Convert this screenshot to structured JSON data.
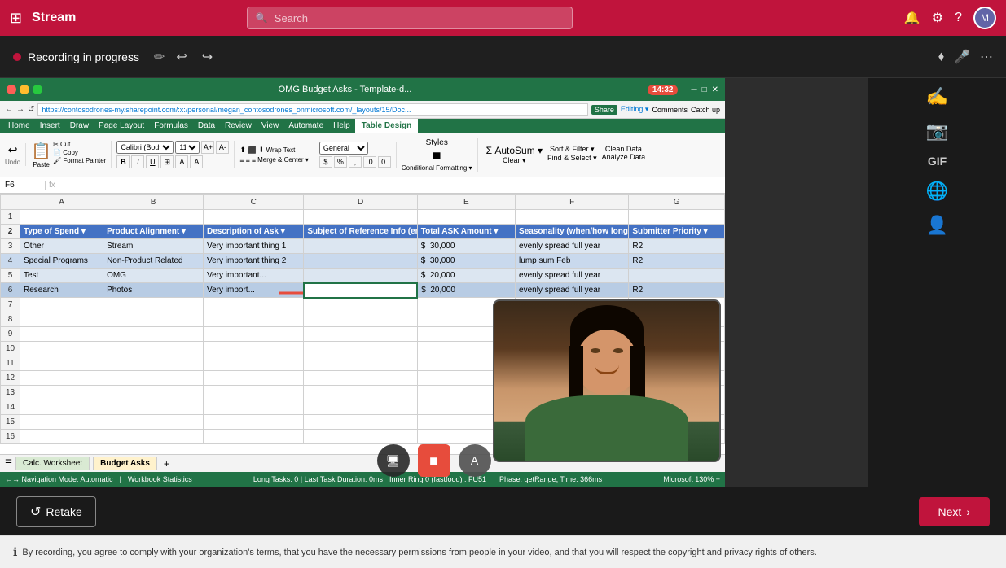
{
  "app": {
    "name": "Stream",
    "search_placeholder": "Search"
  },
  "topnav": {
    "grid_icon": "⊞",
    "notification_icon": "🔔",
    "settings_icon": "⚙",
    "help_icon": "?",
    "avatar_text": "M"
  },
  "recording_bar": {
    "status": "Recording in progress",
    "undo_icon": "↩",
    "redo_icon": "↪",
    "pen_icon": "✏",
    "wand_icon": "⬦",
    "more_icon": "⋯"
  },
  "excel": {
    "title": "OMG Budget Asks - Template-d...",
    "url": "https://contosodrones-my.sharepoint.com/:x:/personal/megan_contosodrones_onmicrosoft.com/_layouts/15/Doc...",
    "timer": "14:32",
    "tabs": [
      "Home",
      "Insert",
      "Draw",
      "Page Layout",
      "Formulas",
      "Data",
      "Review",
      "View",
      "Automate",
      "Help",
      "Table Design"
    ],
    "active_tab": "Table Design",
    "formula_bar_ref": "F6",
    "formula_bar_value": "",
    "sheet_tabs": [
      "Calc. Worksheet",
      "Budget Asks"
    ],
    "columns": [
      "Type of Spend",
      "Product Alignment",
      "Description of Ask",
      "Subject of Reference Info (email or other...)",
      "Total ASK Amount",
      "Seasonality (when/how long)",
      "Submitter Priority"
    ],
    "rows": [
      {
        "num": "3",
        "type": "Other",
        "product": "Stream",
        "desc": "Very important thing 1",
        "subject": "",
        "amount": "$ 30,000",
        "season": "evenly spread full year",
        "priority": "R2"
      },
      {
        "num": "4",
        "type": "Special Programs",
        "product": "Non-Product Related",
        "desc": "Very important thing 2",
        "subject": "",
        "amount": "$ 30,000",
        "season": "lump sum Feb",
        "priority": "R2"
      },
      {
        "num": "5",
        "type": "Test",
        "product": "OMG",
        "desc": "Very important...",
        "subject": "",
        "amount": "$ 20,000",
        "season": "evenly spread full year",
        "priority": ""
      },
      {
        "num": "6",
        "type": "Research",
        "product": "Photos",
        "desc": "Very import...",
        "subject": "",
        "amount": "$ 20,000",
        "season": "evenly spread full year",
        "priority": "R2"
      }
    ]
  },
  "bottom": {
    "retake_label": "Retake",
    "next_label": "Next",
    "disclaimer": "By recording, you agree to comply with your organization's terms, that you have the necessary permissions from people in your video, and that you will respect the copyright and privacy rights of others."
  },
  "sidebar_tools": [
    {
      "name": "pen-tool",
      "icon": "✍"
    },
    {
      "name": "camera-tool",
      "icon": "📷"
    },
    {
      "name": "gif-tool",
      "icon": "GIF"
    },
    {
      "name": "globe-tool",
      "icon": "🌐"
    },
    {
      "name": "people-tool",
      "icon": "👤"
    }
  ],
  "screen_controls": [
    {
      "name": "screen-share-desktop",
      "icon": "🖥"
    },
    {
      "name": "screen-share-window",
      "icon": "⬜"
    },
    {
      "name": "screen-share-region",
      "icon": "▣"
    }
  ]
}
